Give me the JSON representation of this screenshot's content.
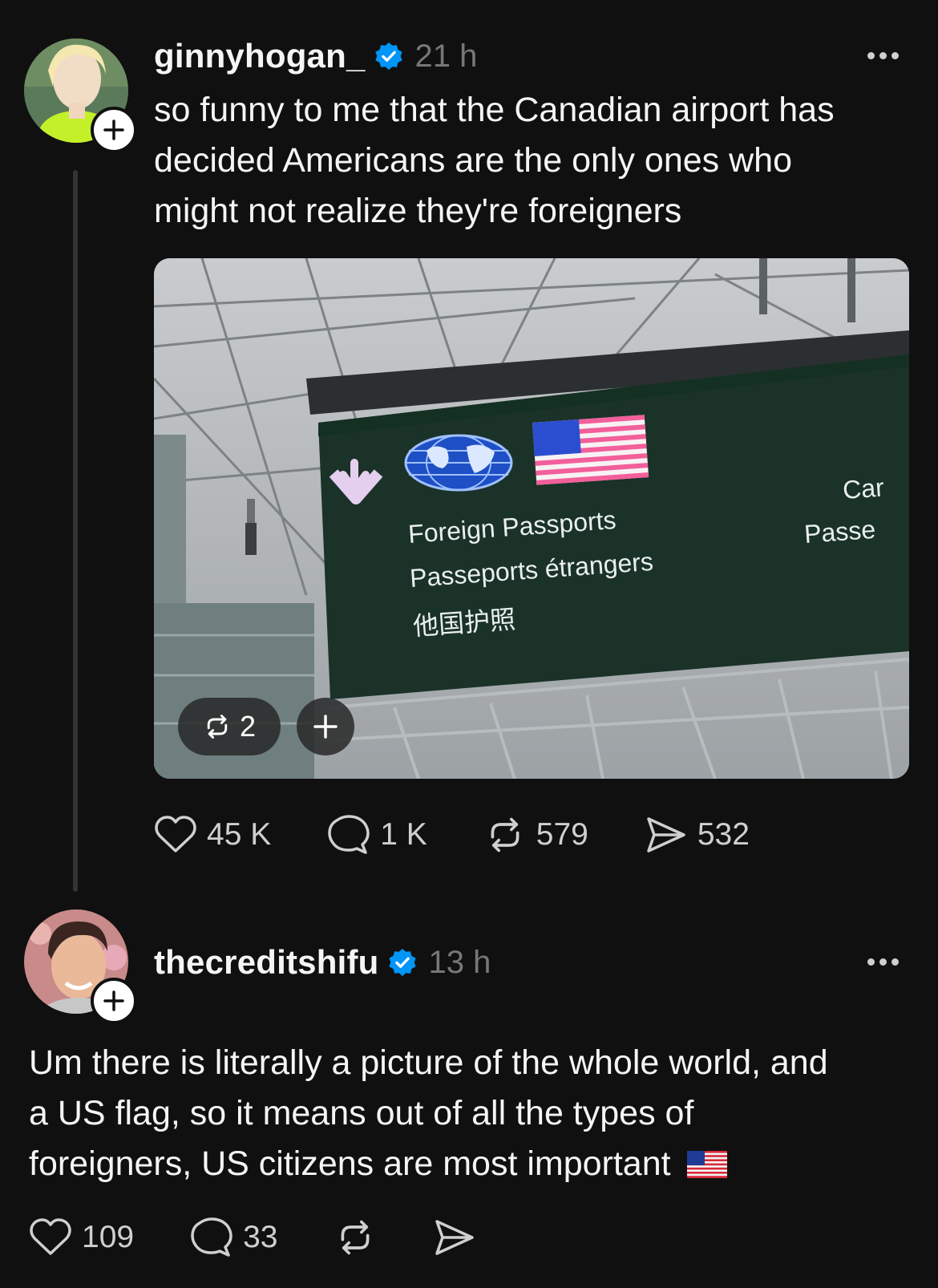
{
  "post": {
    "username": "ginnyhogan_",
    "time": "21 h",
    "text_lines": [
      "so funny to me that the Canadian airport has",
      "decided Americans are the only ones who",
      "might not realize they're foreigners"
    ],
    "image": {
      "sign_line1": "Foreign Passports",
      "sign_line2": "Passeports étrangers",
      "sign_line3": "他国护照",
      "sign_right1": "Car",
      "sign_right2": "Passe",
      "repost_count": "2"
    },
    "likes": "45 K",
    "replies": "1 K",
    "reposts": "579",
    "shares": "532"
  },
  "reply": {
    "username": "thecreditshifu",
    "time": "13 h",
    "text_lines": [
      "Um there is literally a picture of the whole world, and",
      "a US flag, so it means out of all the types of",
      "foreigners, US citizens are most important"
    ],
    "flag_emoji": "🇺🇸",
    "likes": "109",
    "replies": "33"
  },
  "icons": {
    "verified": "verified-badge-icon",
    "more": "more-dots-icon",
    "like": "heart-icon",
    "reply": "comment-icon",
    "repost": "repost-icon",
    "share": "send-icon",
    "follow": "plus-icon"
  },
  "colors": {
    "background": "#101010",
    "verified_blue": "#0095f6",
    "muted_text": "#777777",
    "sign_green": "#1b3229"
  }
}
